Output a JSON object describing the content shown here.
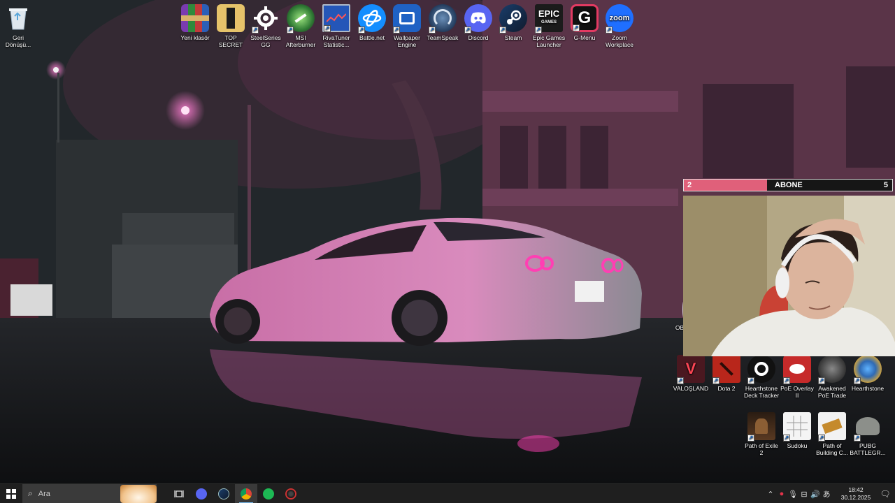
{
  "desktop": {
    "top_icons": [
      {
        "label": "Geri\nDönüşü...",
        "icon": "recycle-bin-icon"
      },
      {
        "label": "Yeni klasör",
        "icon": "winrar-archive-icon"
      },
      {
        "label": "TOP SECRET",
        "icon": "folder-icon"
      },
      {
        "label": "SteelSeries GG",
        "icon": "steelseries-icon"
      },
      {
        "label": "MSI Afterburner",
        "icon": "msi-afterburner-icon"
      },
      {
        "label": "RivaTuner Statistic...",
        "icon": "rivatuner-icon"
      },
      {
        "label": "Battle.net",
        "icon": "battlenet-icon"
      },
      {
        "label": "Wallpaper Engine",
        "icon": "wallpaper-engine-icon"
      },
      {
        "label": "TeamSpeak",
        "icon": "teamspeak-icon"
      },
      {
        "label": "Discord",
        "icon": "discord-icon"
      },
      {
        "label": "Steam",
        "icon": "steam-icon"
      },
      {
        "label": "Epic Games Launcher",
        "icon": "epic-games-icon"
      },
      {
        "label": "G-Menu",
        "icon": "g-menu-icon"
      },
      {
        "label": "Zoom Workplace",
        "icon": "zoom-icon"
      }
    ],
    "right_icons_row1": [
      {
        "label": "VALOŞLAND",
        "icon": "valorant-icon"
      },
      {
        "label": "Dota 2",
        "icon": "dota2-icon"
      },
      {
        "label": "Hearthstone Deck Tracker",
        "icon": "hdt-icon"
      },
      {
        "label": "PoE Overlay II",
        "icon": "poe-overlay-icon"
      },
      {
        "label": "Awakened PoE Trade",
        "icon": "awakened-poe-icon"
      },
      {
        "label": "Hearthstone",
        "icon": "hearthstone-icon"
      }
    ],
    "right_icons_row2": [
      {
        "label": "Path of Exile 2",
        "icon": "path-of-exile-icon"
      },
      {
        "label": "Sudoku",
        "icon": "sudoku-icon"
      },
      {
        "label": "Path of Building C...",
        "icon": "path-of-building-icon"
      },
      {
        "label": "PUBG BATTLEGR...",
        "icon": "pubg-icon"
      }
    ],
    "partial_icon_label": "OB"
  },
  "subscriber_widget": {
    "current": "2",
    "label": "ABONE",
    "goal": "5",
    "progress": 0.4,
    "fill_color": "#e0607a"
  },
  "taskbar": {
    "search_placeholder": "Ara",
    "apps": [
      "task-view-icon",
      "discord-icon",
      "steam-icon",
      "chrome-icon",
      "spotify-icon",
      "msi-afterburner-icon"
    ],
    "active_app": "chrome-icon",
    "clock_time": "18:42",
    "clock_date": "30.12.2025"
  },
  "colors": {
    "taskbar_bg": "#1f1f1f",
    "accent_pink": "#e0607a",
    "discord": "#5865f2",
    "spotify": "#1db954"
  }
}
